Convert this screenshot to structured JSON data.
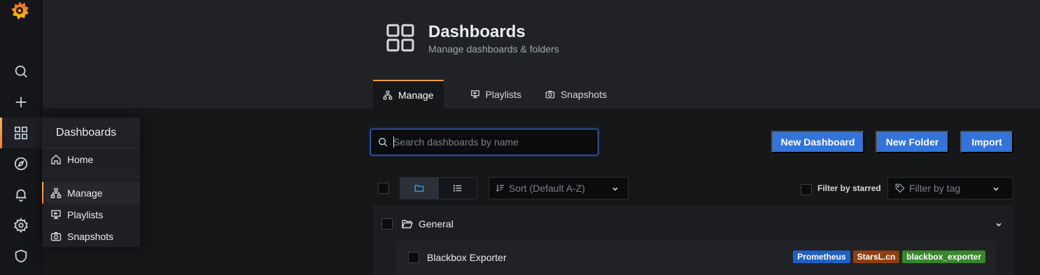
{
  "sidebar": {
    "icons": [
      "grafana-logo",
      "search-icon",
      "plus-icon",
      "dashboards-icon",
      "compass-icon",
      "bell-icon",
      "gear-icon",
      "shield-icon"
    ]
  },
  "flyout": {
    "title": "Dashboards",
    "items": [
      {
        "label": "Home",
        "icon": "home-icon"
      },
      {
        "label": "Manage",
        "icon": "sitemap-icon",
        "active": true
      },
      {
        "label": "Playlists",
        "icon": "presentation-icon"
      },
      {
        "label": "Snapshots",
        "icon": "camera-icon"
      }
    ]
  },
  "header": {
    "title": "Dashboards",
    "subtitle": "Manage dashboards & folders",
    "tabs": [
      {
        "label": "Manage",
        "active": true
      },
      {
        "label": "Playlists"
      },
      {
        "label": "Snapshots"
      }
    ]
  },
  "toolbar": {
    "search_placeholder": "Search dashboards by name",
    "search_value": "",
    "new_dashboard": "New Dashboard",
    "new_folder": "New Folder",
    "import": "Import",
    "sort_placeholder": "Sort (Default A-Z)",
    "filter_starred": "Filter by starred",
    "filter_tag_placeholder": "Filter by tag"
  },
  "results": {
    "folder": "General",
    "dashboards": [
      {
        "title": "Blackbox Exporter",
        "tags": [
          {
            "label": "Prometheus",
            "color": "#1f60c4"
          },
          {
            "label": "StarsL.cn",
            "color": "#8f3f0f"
          },
          {
            "label": "blackbox_exporter",
            "color": "#37872d"
          }
        ]
      }
    ]
  },
  "colors": {
    "accent": "#3274d9",
    "active_bar": "#f59e42"
  }
}
